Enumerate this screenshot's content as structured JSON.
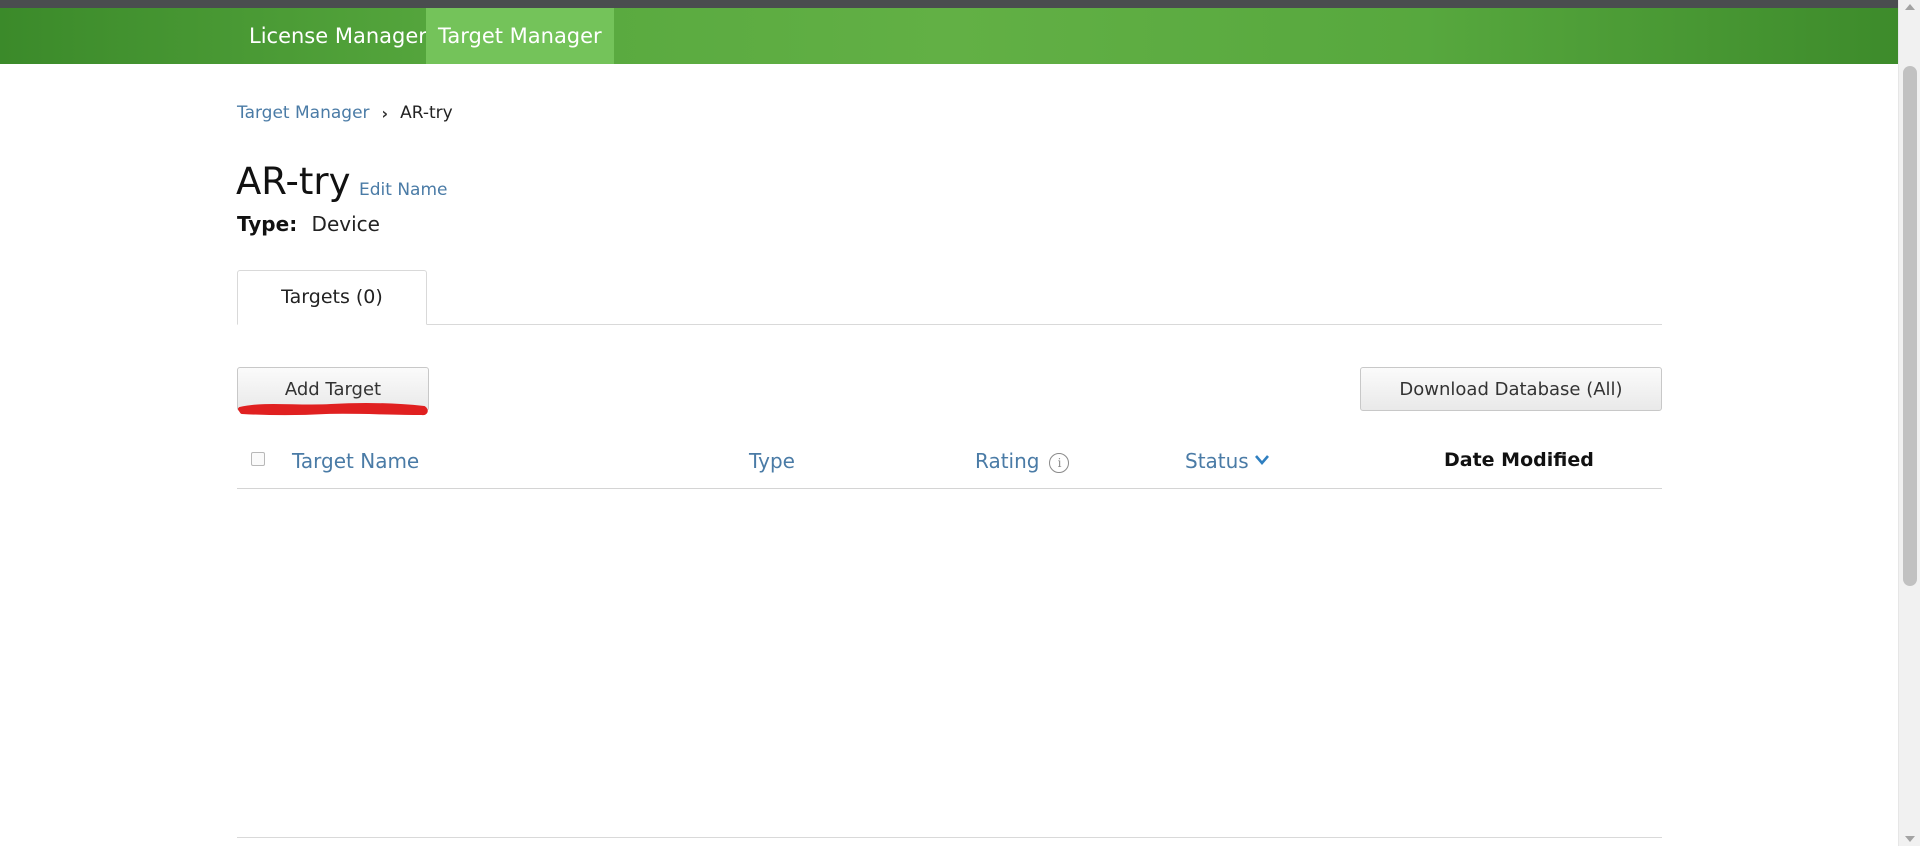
{
  "nav": {
    "items": [
      {
        "label": "License Manager"
      },
      {
        "label": "Target Manager",
        "active": true
      }
    ],
    "gradient_colors": [
      "#3b8a2a",
      "#62b045"
    ],
    "active_color": "#74c35a"
  },
  "breadcrumb": {
    "parent": "Target Manager",
    "separator": "›",
    "current": "AR-try"
  },
  "header": {
    "title": "AR-try",
    "edit_label": "Edit Name",
    "type_label": "Type:",
    "type_value": "Device"
  },
  "tabs": [
    {
      "label": "Targets (0)",
      "active": true
    }
  ],
  "toolbar": {
    "add_label": "Add Target",
    "download_label": "Download Database (All)"
  },
  "table": {
    "columns": [
      {
        "label": "Target Name",
        "sortable": true
      },
      {
        "label": "Type",
        "sortable": true
      },
      {
        "label": "Rating",
        "sortable": true,
        "icon": "info-icon"
      },
      {
        "label": "Status",
        "sortable": true,
        "icon": "chevron-down-icon"
      },
      {
        "label": "Date Modified",
        "sortable": false
      }
    ],
    "rows": []
  },
  "annotation": {
    "color": "#e02020"
  },
  "link_color": "#4a7ba6"
}
